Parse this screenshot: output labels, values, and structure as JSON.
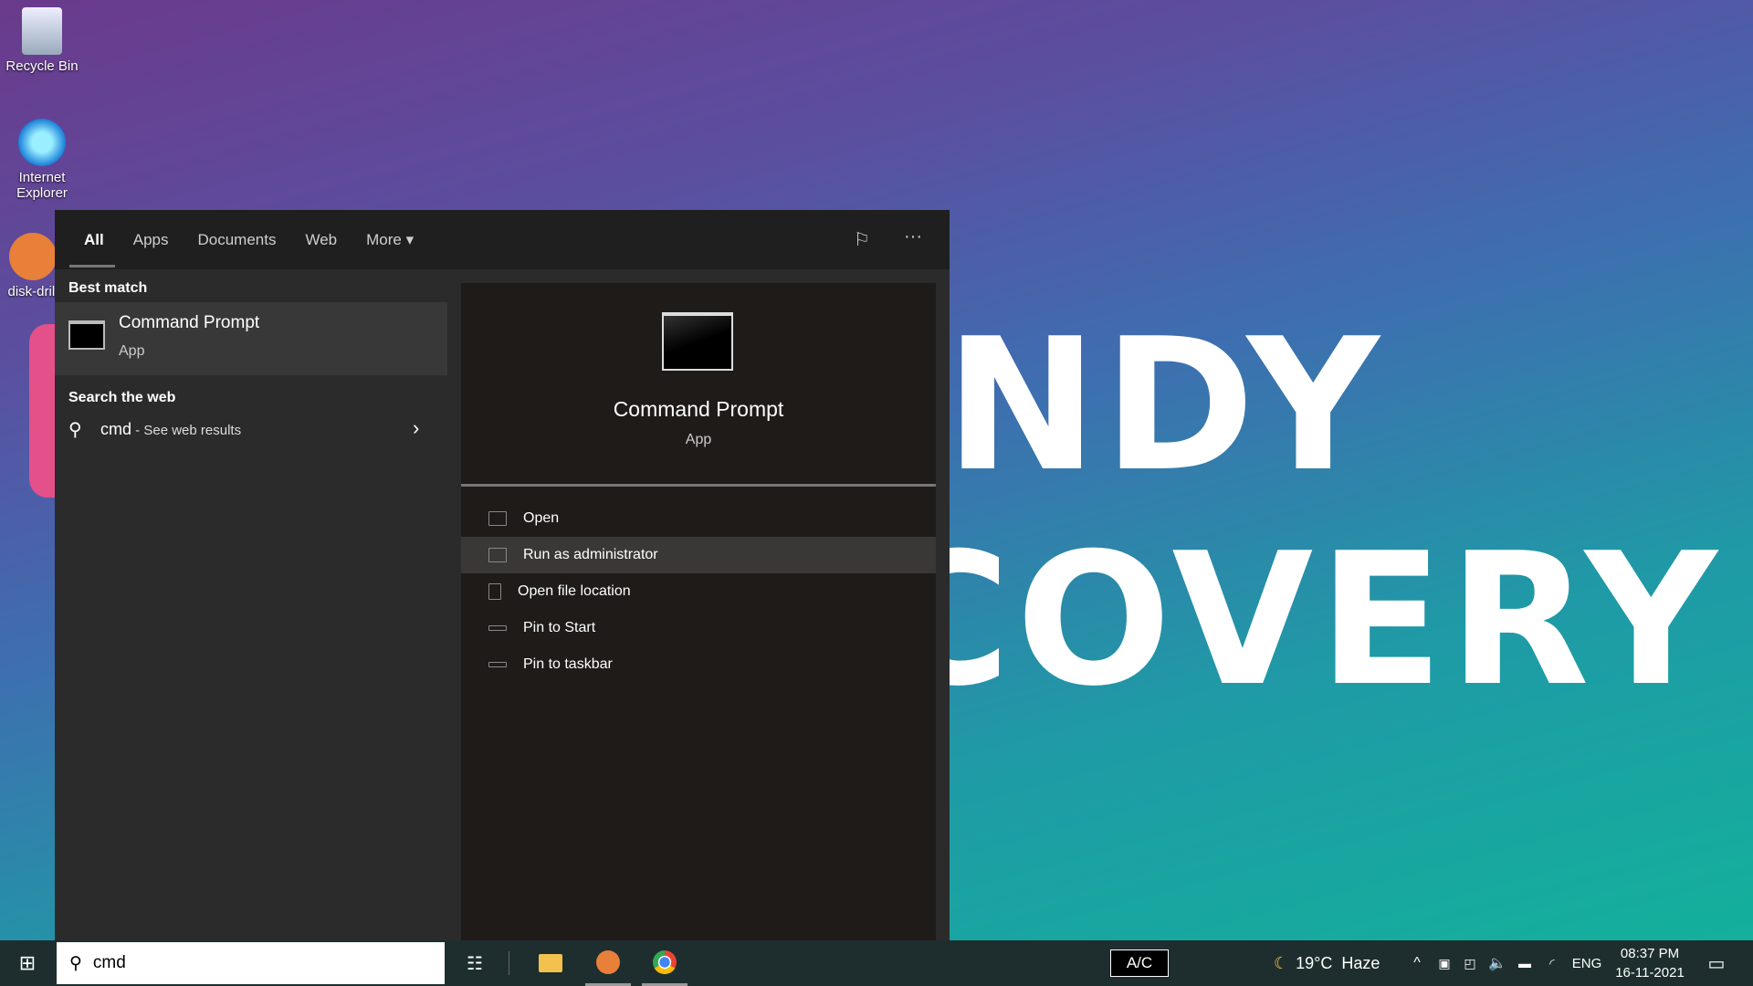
{
  "wallpaper": {
    "line1": "NDY",
    "line2": "COVERY"
  },
  "desktop": {
    "icons": [
      {
        "label": "Recycle Bin"
      },
      {
        "label": "Internet Explorer"
      },
      {
        "label": "disk-drill"
      }
    ]
  },
  "search": {
    "tabs": [
      {
        "label": "All",
        "active": true
      },
      {
        "label": "Apps"
      },
      {
        "label": "Documents"
      },
      {
        "label": "Web"
      },
      {
        "label": "More"
      }
    ],
    "best_match_heading": "Best match",
    "best_match": {
      "title": "Command Prompt",
      "subtitle": "App"
    },
    "web_heading": "Search the web",
    "web_result": {
      "query": "cmd",
      "suffix": " - See web results"
    },
    "preview": {
      "title": "Command Prompt",
      "subtitle": "App"
    },
    "actions": [
      {
        "label": "Open",
        "icon": "open-icon"
      },
      {
        "label": "Run as administrator",
        "icon": "shield-icon",
        "highlighted": true
      },
      {
        "label": "Open file location",
        "icon": "folder-icon"
      },
      {
        "label": "Pin to Start",
        "icon": "pin-icon"
      },
      {
        "label": "Pin to taskbar",
        "icon": "pin-icon"
      }
    ]
  },
  "taskbar": {
    "search_value": "cmd",
    "ac_label": "A/C",
    "weather": "19°C  Haze",
    "language": "ENG",
    "time": "08:37 PM",
    "date": "16-11-2021"
  }
}
